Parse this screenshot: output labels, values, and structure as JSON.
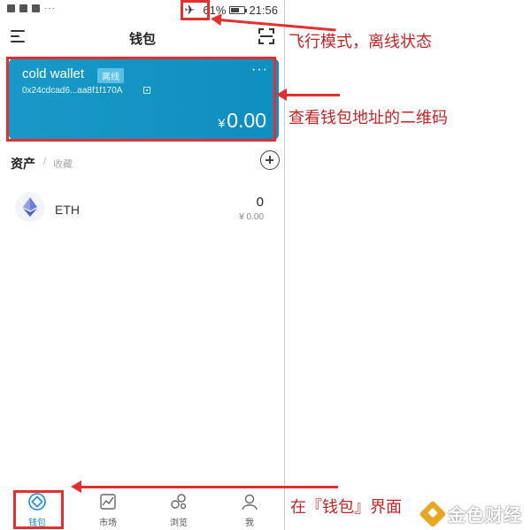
{
  "status_bar": {
    "battery": "61%",
    "battery_level": 0.61,
    "time": "21:56"
  },
  "header": {
    "title": "钱包"
  },
  "wallet_card": {
    "name": "cold wallet",
    "badge": "离线",
    "more": "···",
    "address": "0x24cdcad6...aa8f1f170A",
    "currency_symbol": "¥",
    "balance": "0.00",
    "color": "#1899c8"
  },
  "assets": {
    "tab_assets": "资产",
    "separator": "/",
    "tab_collect": "收藏",
    "items": [
      {
        "symbol": "ETH",
        "amount": "0",
        "value": "¥ 0.00",
        "icon": "ethereum-icon"
      }
    ]
  },
  "nav": {
    "items": [
      {
        "label": "钱包",
        "icon": "wallet-icon",
        "active": true
      },
      {
        "label": "市场",
        "icon": "market-chart-icon",
        "active": false
      },
      {
        "label": "浏览",
        "icon": "browse-icon",
        "active": false
      },
      {
        "label": "我",
        "icon": "profile-icon",
        "active": false
      }
    ],
    "active_color": "#1a88d6"
  },
  "annotations": {
    "airplane_note": "飞行模式，离线状态",
    "qr_note": "查看钱包地址的二维码",
    "wallet_note": "在『钱包』界面",
    "color": "#e0302f"
  },
  "watermark": {
    "text": "金色财经"
  }
}
